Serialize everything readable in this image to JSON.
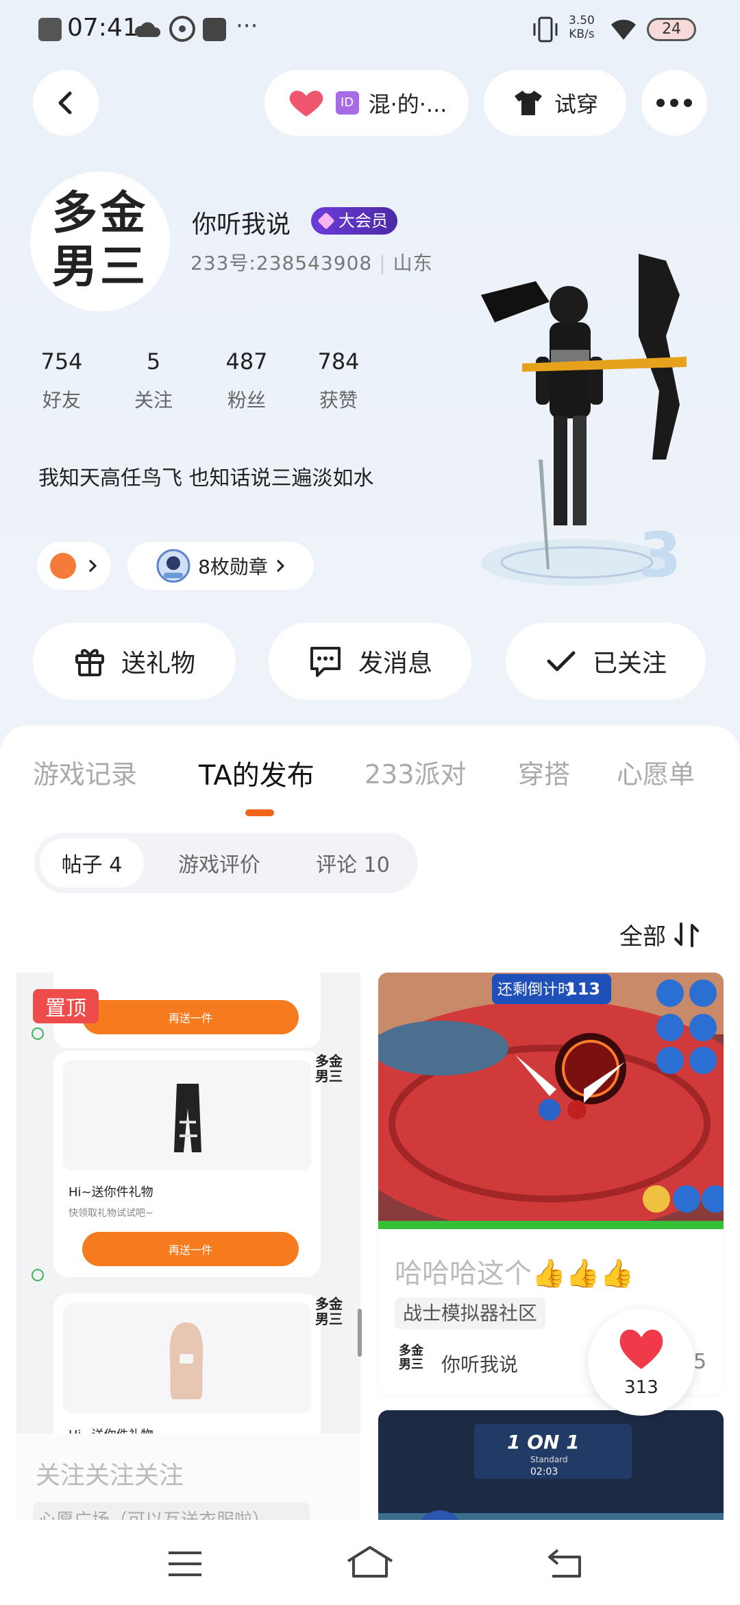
{
  "status_bar": {
    "time": "07:41",
    "net_speed": "3.50",
    "net_unit": "KB/s",
    "battery": "24"
  },
  "topbar": {
    "app_pill_text": "混·的·...",
    "try_on_label": "试穿"
  },
  "profile": {
    "avatar_text": "多金男三",
    "name": "你听我说",
    "vip_label": "大会员",
    "id_text": "233号:238543908",
    "location": "山东",
    "stats": [
      {
        "value": "754",
        "label": "好友"
      },
      {
        "value": "5",
        "label": "关注"
      },
      {
        "value": "487",
        "label": "粉丝"
      },
      {
        "value": "784",
        "label": "获赞"
      }
    ],
    "bio": "我知天高任鸟飞  也知话说三遍淡如水",
    "medals_label": "8枚勋章"
  },
  "actions": {
    "gift": "送礼物",
    "message": "发消息",
    "followed": "已关注"
  },
  "tabs": [
    "游戏记录",
    "TA的发布",
    "233派对",
    "穿搭",
    "心愿单"
  ],
  "active_tab": 1,
  "segments": [
    "帖子 4",
    "游戏评价",
    "评论 10"
  ],
  "sort_label": "全部",
  "left_post": {
    "pin_label": "置顶",
    "send_again": "再送一件",
    "gift_title": "Hi~送你件礼物",
    "gift_sub": "快领取礼物试试吧~",
    "author_avatar": "多金男三",
    "bottom_title": "关注关注关注",
    "bottom_sub": "心愿广场（可以互送衣服啦）"
  },
  "right_post": {
    "hud_title": "还剩倒计时",
    "hud_count": "113",
    "title": "哈哈哈这个👍👍👍",
    "tag": "战士模拟器社区",
    "author_avatar": "多金男三",
    "author_name": "你听我说",
    "count": "5"
  },
  "like_count": "313",
  "second_post": {
    "badge": "1 ON 1",
    "sub": "Standard",
    "timer": "02:03"
  },
  "colors": {
    "accent": "#f2661b",
    "vip": "#5a2fbf",
    "pin": "#ee4b4b"
  }
}
